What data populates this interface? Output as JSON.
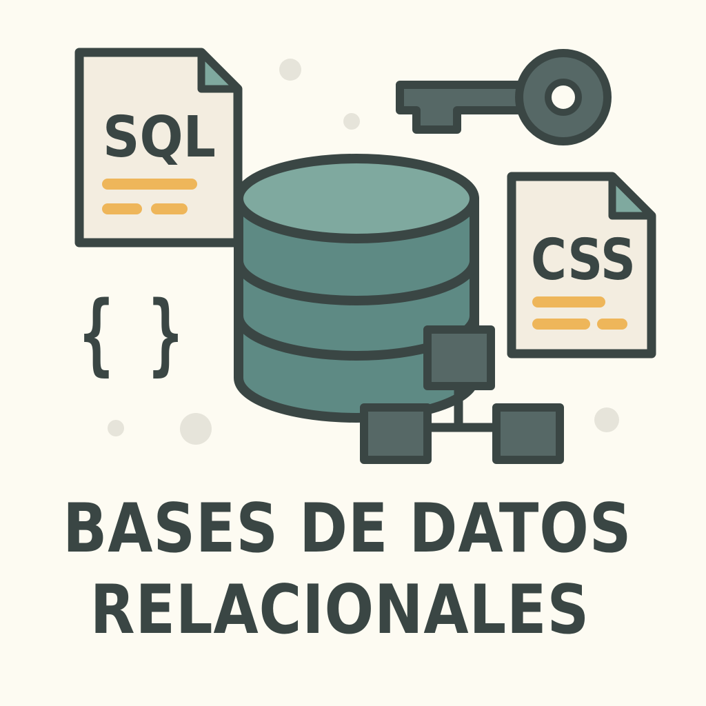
{
  "illustration": {
    "sql_document": {
      "label": "SQL",
      "icon": "sql-file-icon"
    },
    "css_document": {
      "label": "CSS",
      "icon": "css-file-icon"
    },
    "braces": {
      "text": "{ }",
      "icon": "code-braces-icon"
    },
    "database": {
      "icon": "database-cylinder-icon"
    },
    "key": {
      "icon": "key-icon"
    },
    "relations": {
      "icon": "relationship-diagram-icon"
    }
  },
  "title": {
    "line1": "BASES DE DATOS",
    "line2": "RELACIONALES"
  },
  "colors": {
    "background": "#fdfbf2",
    "outline": "#3a4644",
    "teal_light": "#7fa99f",
    "teal": "#5e8a84",
    "teal_dark": "#566866",
    "paper": "#f3ede0",
    "accent": "#eeb65a",
    "dot": "#e6e4da"
  }
}
